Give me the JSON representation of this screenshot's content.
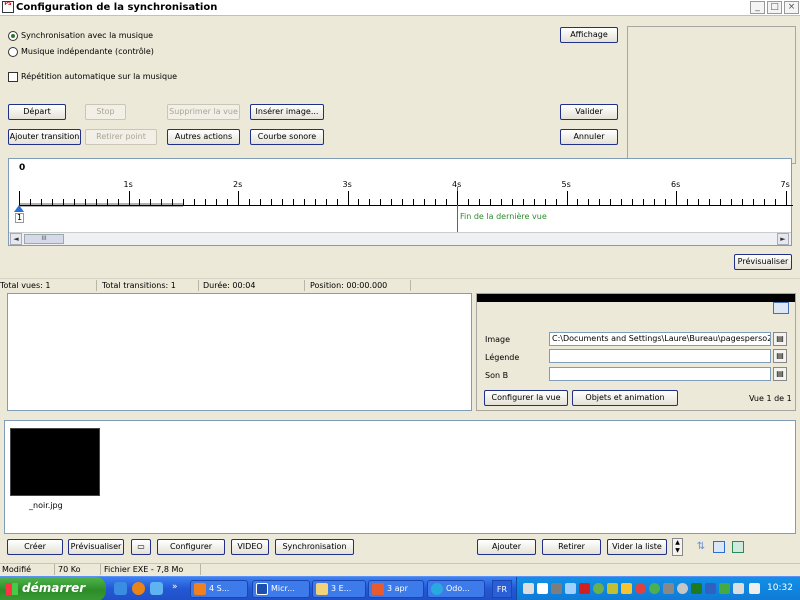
{
  "window": {
    "title": "Configuration de la synchronisation",
    "icon_text": "PS",
    "controls": {
      "minimize": "_",
      "maximize": "□",
      "close": "×"
    }
  },
  "options": {
    "radio_sync": "Synchronisation avec la musique",
    "radio_independent": "Musique indépendante (contrôle)",
    "radio_selected": "sync",
    "checkbox_repeat": "Répétition automatique sur la musique",
    "checkbox_repeat_checked": false
  },
  "buttons": {
    "affichage": "Affichage",
    "depart": "Départ",
    "stop": "Stop",
    "supprimer_vue": "Supprimer la vue",
    "inserer_image": "Insérer image...",
    "valider": "Valider",
    "ajouter_transition": "Ajouter transition",
    "retirer_point": "Retirer point",
    "autres_actions": "Autres actions",
    "courbe_sonore": "Courbe sonore",
    "annuler": "Annuler",
    "previsualiser": "Prévisualiser"
  },
  "timeline": {
    "zero_label": "0",
    "tick_labels": [
      "1s",
      "2s",
      "3s",
      "4s",
      "5s",
      "6s",
      "7s"
    ],
    "end_label": "Fin de la dernière vue",
    "marker_number": "1",
    "scroll_left": "◄",
    "scroll_right": "►",
    "scroll_thumb": "III"
  },
  "stats": {
    "total_vues": "Total vues: 1",
    "total_transitions": "Total transitions: 1",
    "duree": "Durée: 00:04",
    "position": "Position: 00:00.000"
  },
  "properties": {
    "image_label": "Image",
    "image_value": "C:\\Documents and Settings\\Laure\\Bureau\\pagesperso200",
    "legende_label": "Légende",
    "legende_value": "",
    "son_label": "Son B",
    "son_value": "",
    "configurer_vue": "Configurer la vue",
    "objets_animation": "Objets et animation",
    "vue_count": "Vue 1 de 1"
  },
  "thumbnail": {
    "name": "_noir.jpg"
  },
  "bottom_buttons": {
    "creer": "Créer",
    "previsualiser": "Prévisualiser",
    "configurer": "Configurer",
    "video": "VIDEO",
    "synchronisation": "Synchronisation",
    "ajouter": "Ajouter",
    "retirer": "Retirer",
    "vider_la_liste": "Vider la liste"
  },
  "status": {
    "modifie": "Modifié",
    "size_k": "70 Ko",
    "fichier_exe": "Fichier EXE - 7,8 Mo"
  },
  "taskbar": {
    "start": "démarrer",
    "tasks": [
      "4 S...",
      "Micr...",
      "3 E...",
      "3 apr",
      "Odo..."
    ],
    "lang": "FR",
    "clock": "10:32"
  }
}
